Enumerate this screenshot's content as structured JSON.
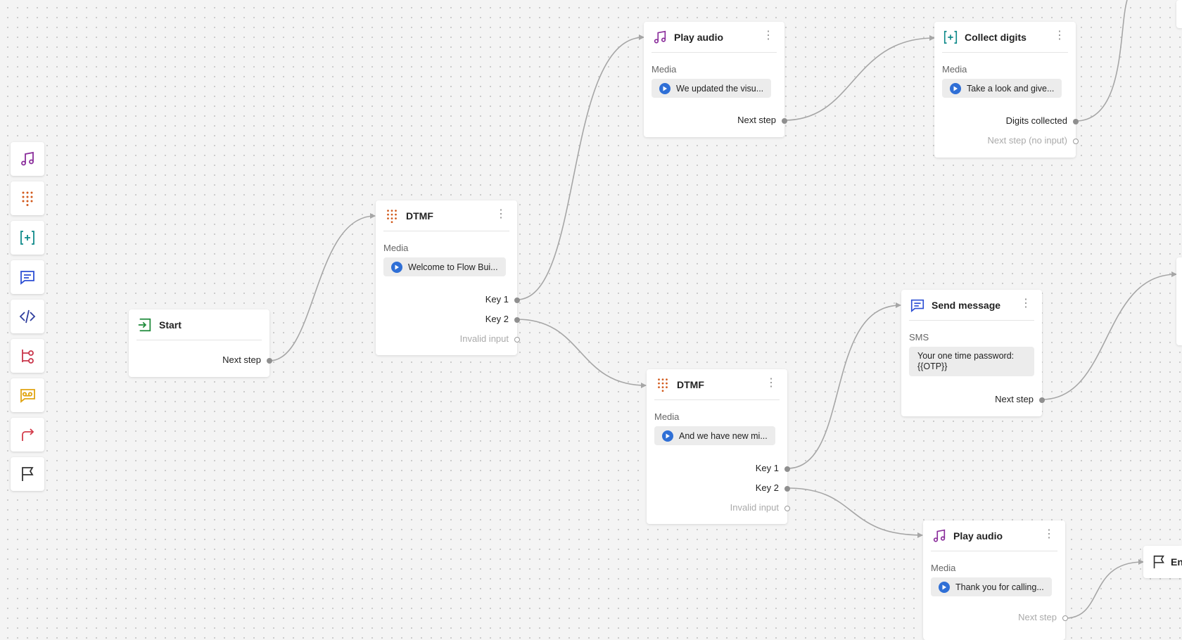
{
  "toolbar": {
    "tools": [
      {
        "icon": "music-note-icon",
        "color": "#8a2d9b",
        "name": "play-audio"
      },
      {
        "icon": "dialpad-icon",
        "color": "#d25a1c",
        "name": "dtmf"
      },
      {
        "icon": "collect-digits-icon",
        "color": "#0f8a8a",
        "name": "collect-digits"
      },
      {
        "icon": "message-icon",
        "color": "#2c4fd4",
        "name": "send-message"
      },
      {
        "icon": "code-icon",
        "color": "#2f3e9e",
        "name": "code"
      },
      {
        "icon": "branch-icon",
        "color": "#c9354a",
        "name": "branch"
      },
      {
        "icon": "voicemail-icon",
        "color": "#e0a411",
        "name": "voicemail"
      },
      {
        "icon": "forward-arrow-icon",
        "color": "#d33b4a",
        "name": "forward"
      },
      {
        "icon": "flag-icon",
        "color": "#333333",
        "name": "end"
      }
    ]
  },
  "nodes": {
    "start": {
      "title": "Start",
      "next": "Next step"
    },
    "dtmf1": {
      "title": "DTMF",
      "media_label": "Media",
      "media": "Welcome to Flow Bui...",
      "key1": "Key 1",
      "key2": "Key 2",
      "invalid": "Invalid input"
    },
    "play1": {
      "title": "Play audio",
      "media_label": "Media",
      "media": "We updated the visu...",
      "next": "Next step"
    },
    "collect": {
      "title": "Collect digits",
      "media_label": "Media",
      "media": "Take a look and give...",
      "digits": "Digits collected",
      "noinput": "Next step (no input)"
    },
    "dtmf2": {
      "title": "DTMF",
      "media_label": "Media",
      "media": "And we have new mi...",
      "key1": "Key 1",
      "key2": "Key 2",
      "invalid": "Invalid input"
    },
    "sms": {
      "title": "Send message",
      "label": "SMS",
      "text": "Your one time password: {{OTP}}",
      "next": "Next step"
    },
    "play2": {
      "title": "Play audio",
      "media_label": "Media",
      "media": "Thank you for calling...",
      "next": "Next step"
    },
    "end": {
      "title": "En"
    }
  },
  "colors": {
    "wire": "#a6a6a6",
    "port": "#8f8f8f",
    "start": "#1e8a3a",
    "dtmf": "#d25a1c",
    "audio": "#8a2d9b",
    "collect": "#0f8a8a",
    "message": "#2c4fd4",
    "play": "#2f6fd6"
  }
}
